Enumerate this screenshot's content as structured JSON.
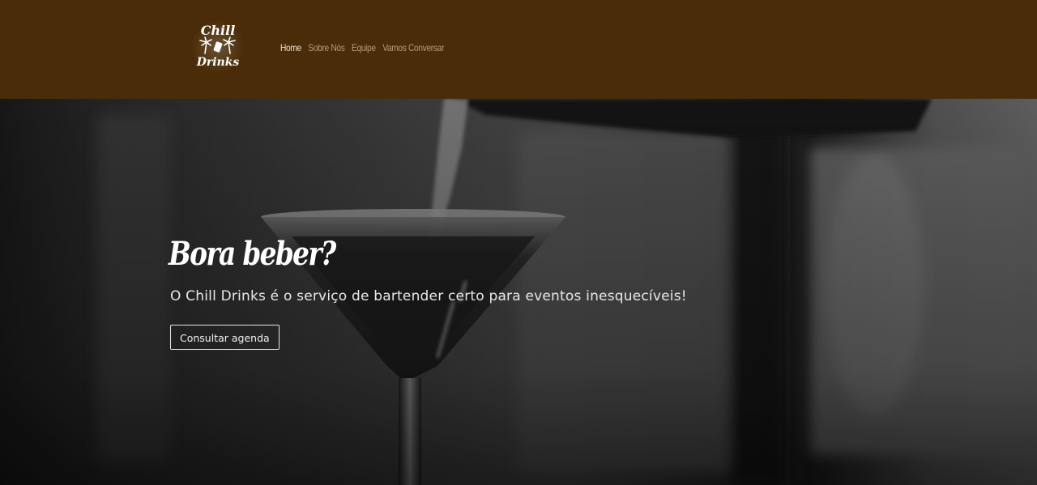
{
  "brand": {
    "logo_line1": "Chill",
    "logo_line2": "Drinks"
  },
  "nav": {
    "items": [
      {
        "label": "Home",
        "active": true
      },
      {
        "label": "Sobre Nós",
        "active": false
      },
      {
        "label": "Equipe",
        "active": false
      },
      {
        "label": "Vamos Conversar",
        "active": false
      }
    ]
  },
  "hero": {
    "title": "Bora beber?",
    "subtitle": "O Chill Drinks é o serviço de bartender certo para eventos inesquecíveis!",
    "cta_label": "Consultar agenda"
  },
  "colors": {
    "navbar_bg": "#4a2c08",
    "nav_active": "#f2e6d6",
    "nav_inactive": "#b89a78"
  }
}
